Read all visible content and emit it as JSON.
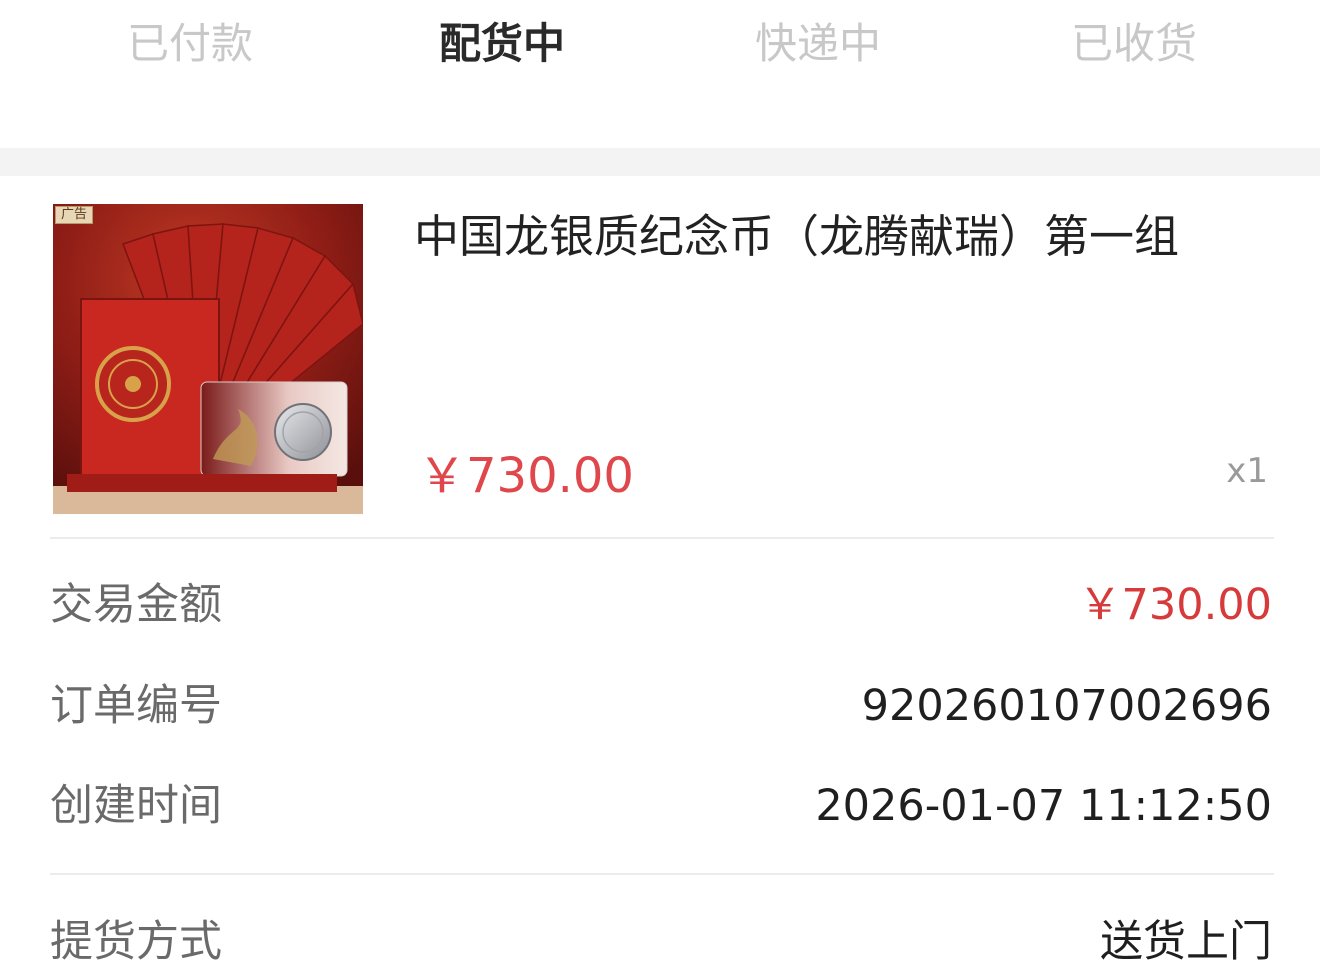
{
  "steps": [
    {
      "label": "已付款",
      "state": "done"
    },
    {
      "label": "配货中",
      "state": "active"
    },
    {
      "label": "快递中",
      "state": "pending"
    },
    {
      "label": "已收货",
      "state": "pending"
    }
  ],
  "product": {
    "ad_tag": "广告",
    "title": "中国龙银质纪念币（龙腾献瑞）第一组",
    "price": "￥730.00",
    "quantity": "x1"
  },
  "order_info": {
    "amount": {
      "label": "交易金额",
      "value": "￥730.00"
    },
    "order_no": {
      "label": "订单编号",
      "value": "920260107002696"
    },
    "created_at": {
      "label": "创建时间",
      "value": "2026-01-07 11:12:50"
    },
    "pickup": {
      "label": "提货方式",
      "value": "送货上门"
    }
  },
  "colors": {
    "accent_red": "#e0474c",
    "amount_red": "#d63a3a",
    "inactive_step": "#c8c8c8",
    "active_step": "#2a2a2a"
  }
}
